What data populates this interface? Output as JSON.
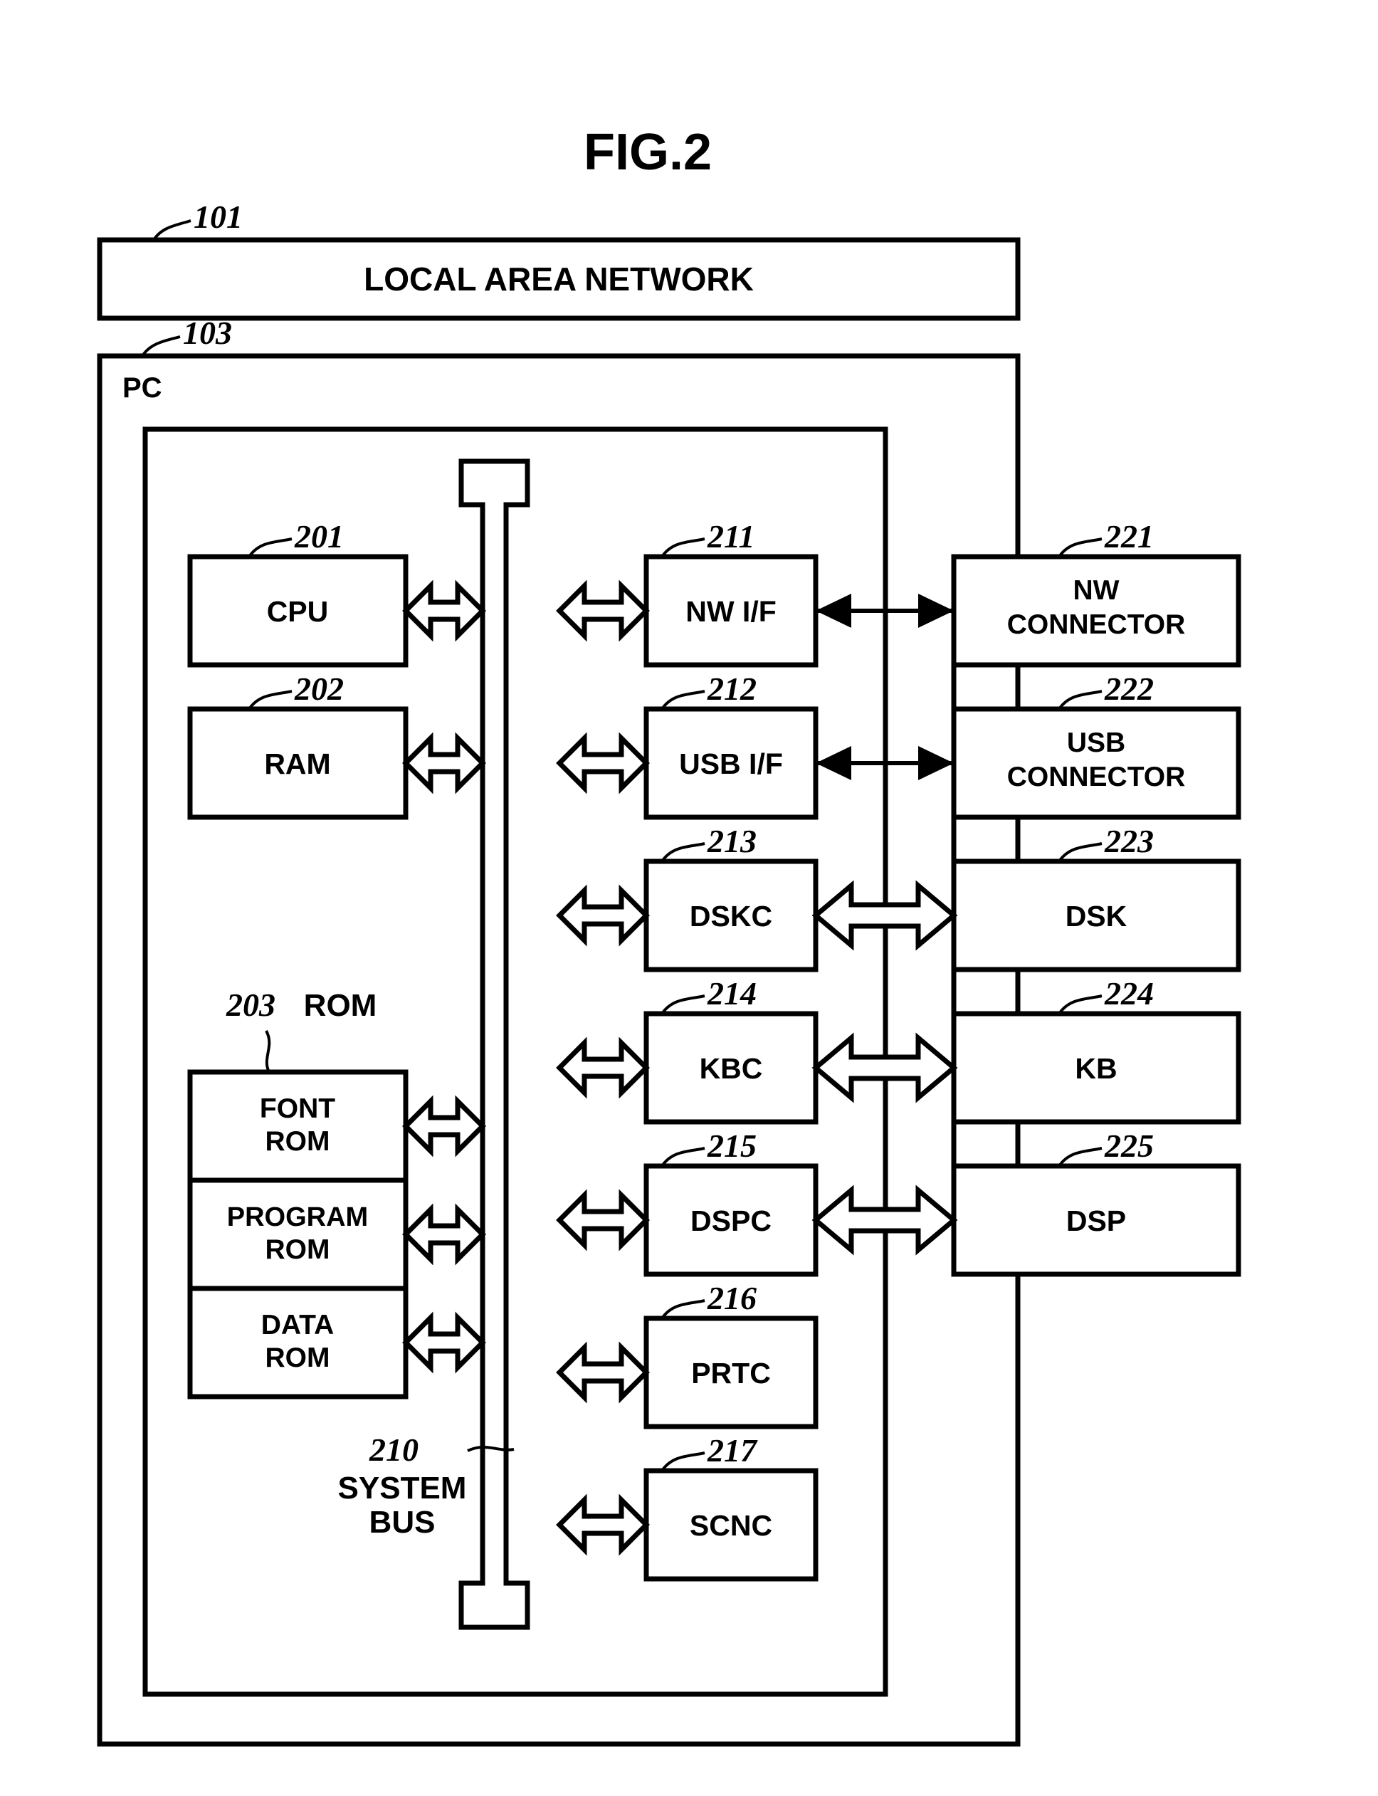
{
  "figure": {
    "title": "FIG.2",
    "pc_label": "PC"
  },
  "refs": {
    "lan": "101",
    "pc": "103",
    "cpu": "201",
    "ram": "202",
    "rom": "203",
    "bus": "210",
    "nwif": "211",
    "usbif": "212",
    "dskc": "213",
    "kbc": "214",
    "dspc": "215",
    "prtc": "216",
    "scnc": "217",
    "nwcon": "221",
    "usbcon": "222",
    "dsk": "223",
    "kb": "224",
    "dsp": "225"
  },
  "blocks": {
    "lan": "LOCAL AREA NETWORK",
    "cpu": "CPU",
    "ram": "RAM",
    "rom_title": "ROM",
    "font_rom_1": "FONT",
    "font_rom_2": "ROM",
    "program_rom_1": "PROGRAM",
    "program_rom_2": "ROM",
    "data_rom_1": "DATA",
    "data_rom_2": "ROM",
    "bus_1": "SYSTEM",
    "bus_2": "BUS",
    "nwif": "NW I/F",
    "usbif": "USB I/F",
    "dskc": "DSKC",
    "kbc": "KBC",
    "dspc": "DSPC",
    "prtc": "PRTC",
    "scnc": "SCNC",
    "nwcon_1": "NW",
    "nwcon_2": "CONNECTOR",
    "usbcon_1": "USB",
    "usbcon_2": "CONNECTOR",
    "dsk": "DSK",
    "kb": "KB",
    "dsp": "DSP"
  },
  "colors": {
    "stroke": "#000000",
    "fill": "#ffffff"
  }
}
